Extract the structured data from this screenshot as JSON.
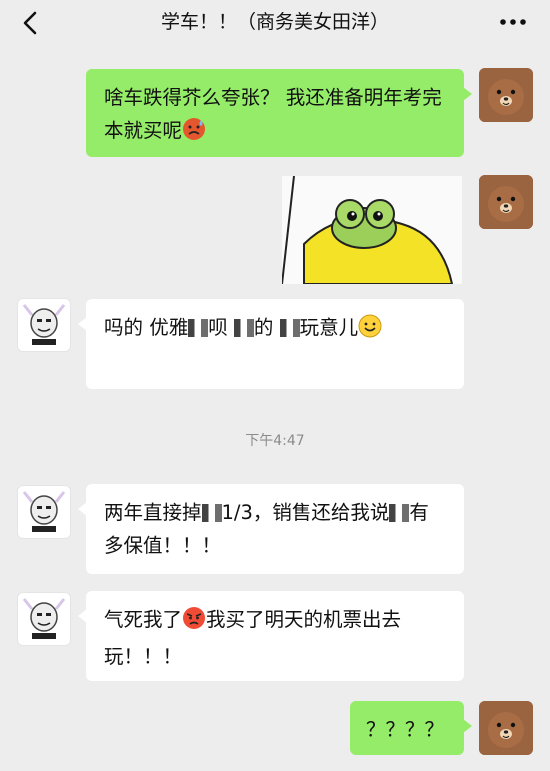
{
  "header": {
    "title": "学车！！（商务美女田洋）",
    "back_icon": "chevron-left-icon",
    "more_icon": "more-dots-icon"
  },
  "messages": [
    {
      "side": "right",
      "type": "text",
      "text": "啥车跌得芥么夸张？ 我还准备明年考完本就买呢",
      "emoji": "anxious-sweat-face"
    },
    {
      "side": "right",
      "type": "sticker",
      "sticker": "frog-peek-sticker"
    },
    {
      "side": "left",
      "type": "text",
      "text_a": "吗的 优雅",
      "text_b": "呗",
      "text_c": "的",
      "text_d": "玩意儿",
      "emoji": "smile-face"
    },
    {
      "side": "left",
      "type": "text",
      "text_a": "两年直接掉",
      "text_b": "1/3，销售还给我说",
      "text_c": "有多保值！！！"
    },
    {
      "side": "left",
      "type": "text",
      "text_a": "气死我了",
      "text_b": "我买了明天的机票出去玩！！！",
      "emoji": "angry-face"
    },
    {
      "side": "right",
      "type": "text",
      "text": "？？？？"
    }
  ],
  "timestamp": "下午4:47",
  "colors": {
    "background": "#ededed",
    "my_bubble": "#95ec69",
    "other_bubble": "#ffffff"
  }
}
